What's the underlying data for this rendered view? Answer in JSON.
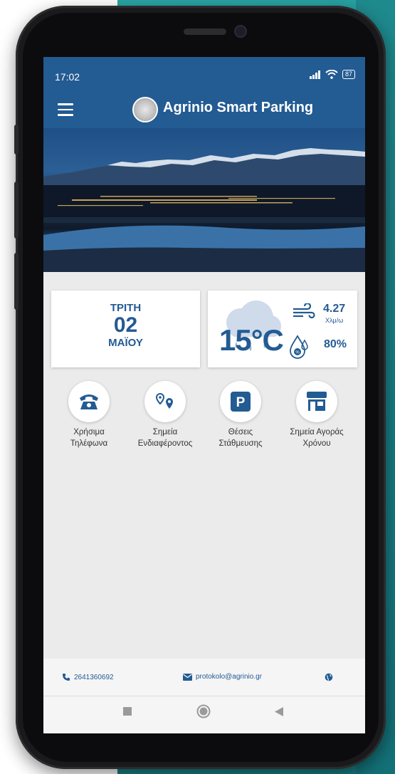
{
  "status_bar": {
    "time": "17:02",
    "battery": "87"
  },
  "app_bar": {
    "title": "Agrinio Smart Parking",
    "menu_icon": "hamburger-menu-icon",
    "logo": "city-seal-logo"
  },
  "hero": {
    "image": "night-city-mountains-lake-photo"
  },
  "date_card": {
    "day": "ΤΡΙΤΗ",
    "date": "02",
    "month": "ΜΑΪΟΥ"
  },
  "weather_card": {
    "temperature": "15°C",
    "wind_speed": "4.27",
    "wind_unit": "Χλμ/ω",
    "humidity": "80%",
    "icons": [
      "cloud-rain-icon",
      "wind-icon",
      "humidity-drop-icon"
    ]
  },
  "quick_actions": [
    {
      "label": "Χρήσιμα\nΤηλέφωνα",
      "icon": "telephone-icon"
    },
    {
      "label": "Σημεία\nΕνδιαφέροντος",
      "icon": "map-pins-icon"
    },
    {
      "label": "Θέσεις\nΣτάθμευσης",
      "icon": "parking-icon"
    },
    {
      "label": "Σημεία Αγοράς\nΧρόνου",
      "icon": "shop-icon"
    }
  ],
  "footer": {
    "phone": "2641360692",
    "email": "protokolo@agrinio.gr",
    "web_icon": "globe-icon"
  },
  "colors": {
    "primary": "#235b93",
    "background": "#ebebeb",
    "teal_backdrop": "#1e8f94"
  }
}
